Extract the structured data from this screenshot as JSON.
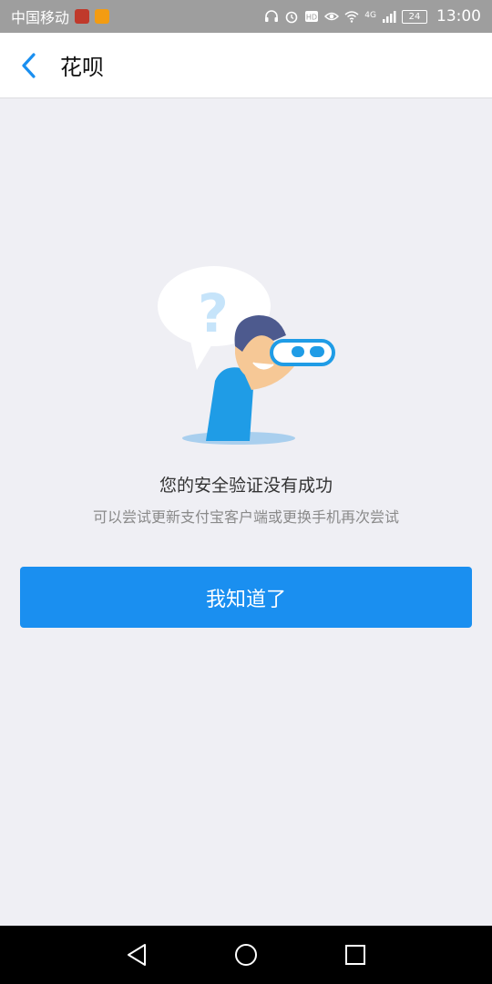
{
  "status_bar": {
    "carrier": "中国移动",
    "network": "4G",
    "battery": "24",
    "time": "13:00",
    "icons": [
      "app-icon-red",
      "app-icon-orange",
      "headphones-icon",
      "alarm-icon",
      "hd-icon",
      "eye-icon",
      "wifi-icon",
      "signal-icon",
      "battery-icon"
    ]
  },
  "header": {
    "back_icon": "chevron-left-icon",
    "title": "花呗"
  },
  "main": {
    "illustration": "person-with-binoculars-question",
    "question_mark": "?",
    "message_title": "您的安全验证没有成功",
    "message_subtitle": "可以尝试更新支付宝客户端或更换手机再次尝试",
    "confirm_label": "我知道了"
  },
  "nav_bar": {
    "icons": [
      "back-triangle-icon",
      "home-circle-icon",
      "recents-square-icon"
    ]
  },
  "colors": {
    "accent": "#1a8ff0",
    "background": "#efeff4",
    "status_bar": "#9e9e9e"
  }
}
